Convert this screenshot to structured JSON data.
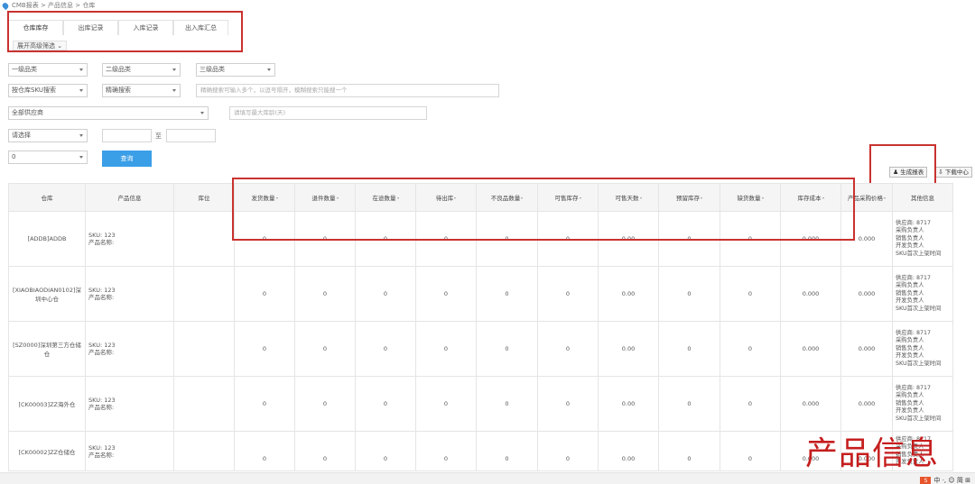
{
  "breadcrumb": "CMB报表 > 产品信息 > 仓库",
  "tabs": [
    "仓库库存",
    "出库记录",
    "入库记录",
    "出入库汇总"
  ],
  "advanced_filter": "展开高级筛选 ⌄",
  "filters": {
    "cat1": "一级品类",
    "cat2": "二级品类",
    "cat3": "三级品类",
    "search_mode": "按仓库SKU搜索",
    "match_mode": "精确搜索",
    "search_placeholder": "精确搜索可输入多个，以逗号隔开，模糊搜索只能搜一个",
    "supplier": "全部供应商",
    "supplier_placeholder": "请填写最大库龄(天)",
    "choose": "请选择",
    "to_label": "至",
    "zero_select": "0",
    "query": "查询"
  },
  "toolbar": {
    "generate": "生成报表",
    "download": "下载中心"
  },
  "table": {
    "headers": [
      "仓库",
      "产品信息",
      "库位",
      "发货数量",
      "退件数量",
      "在途数量",
      "待出库",
      "不良品数量",
      "可售库存",
      "可售天数",
      "预留库存",
      "缺货数量",
      "库存成本",
      "产品采购价格",
      "其他信息"
    ],
    "rows": [
      {
        "warehouse": "[ADDB]ADDB",
        "sku": "SKU: 123",
        "pname": "产品名称:",
        "values": [
          "0",
          "0",
          "0",
          "0",
          "0",
          "0",
          "0.00",
          "0",
          "0",
          "0.000",
          "0.000"
        ],
        "other": [
          "供应商: 8717",
          "采购负责人",
          "销售负责人",
          "开发负责人",
          "SKU首次上架时间"
        ]
      },
      {
        "warehouse": "[XIAOBIAODIAN0102]深圳中心仓",
        "sku": "SKU: 123",
        "pname": "产品名称:",
        "values": [
          "0",
          "0",
          "0",
          "0",
          "0",
          "0",
          "0.00",
          "0",
          "0",
          "0.000",
          "0.000"
        ],
        "other": [
          "供应商: 8717",
          "采购负责人",
          "销售负责人",
          "开发负责人",
          "SKU首次上架时间"
        ]
      },
      {
        "warehouse": "[SZ0000]深圳第三方仓储仓",
        "sku": "SKU: 123",
        "pname": "产品名称:",
        "values": [
          "0",
          "0",
          "0",
          "0",
          "0",
          "0",
          "0.00",
          "0",
          "0",
          "0.000",
          "0.000"
        ],
        "other": [
          "供应商: 8717",
          "采购负责人",
          "销售负责人",
          "开发负责人",
          "SKU首次上架时间"
        ]
      },
      {
        "warehouse": "[CK00003]ZZ海外仓",
        "sku": "SKU: 123",
        "pname": "产品名称:",
        "values": [
          "0",
          "0",
          "0",
          "0",
          "0",
          "0",
          "0.00",
          "0",
          "0",
          "0.000",
          "0.000"
        ],
        "other": [
          "供应商: 8717",
          "采购负责人",
          "销售负责人",
          "开发负责人",
          "SKU首次上架时间"
        ]
      },
      {
        "warehouse": "[CK00002]ZZ仓储仓",
        "sku": "SKU: 123",
        "pname": "产品名称:",
        "values": [
          "0",
          "0",
          "0",
          "0",
          "0",
          "0",
          "0.00",
          "0",
          "0",
          "0.000",
          "0.000"
        ],
        "other": [
          "供应商: 8717",
          "采购负责人",
          "销售负责人",
          "开发负责人"
        ]
      }
    ]
  },
  "watermark": "产品信息",
  "ime": "中 ·, ☺ 简 ⊞",
  "colors": {
    "highlight_box": "#c9322f",
    "query_button": "#3b9fe8",
    "watermark": "#c51e1e"
  }
}
